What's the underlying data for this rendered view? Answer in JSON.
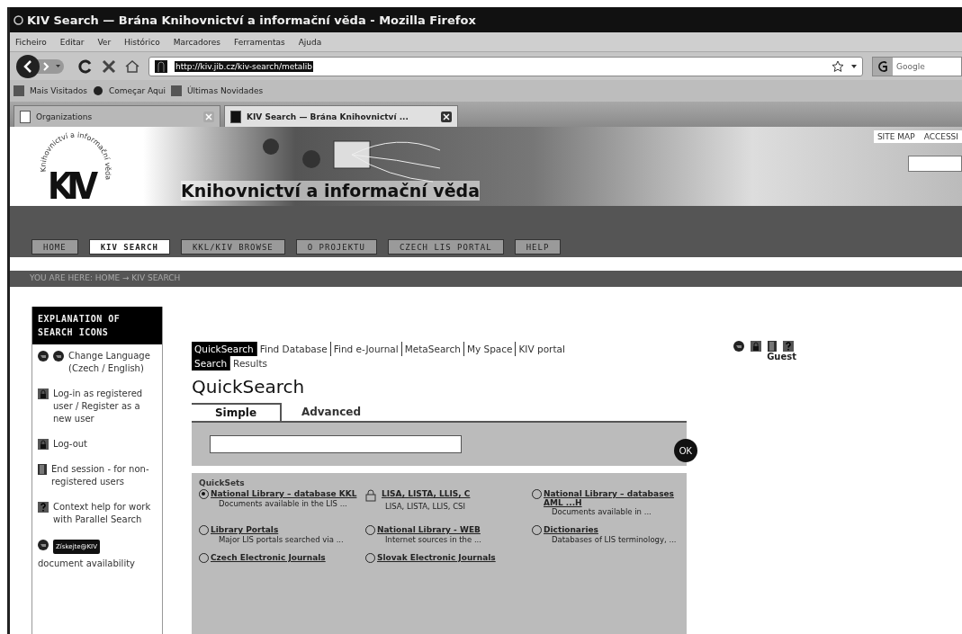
{
  "window": {
    "title": "KIV Search — Brána Knihovnictví a informační věda - Mozilla Firefox"
  },
  "menu": [
    "Ficheiro",
    "Editar",
    "Ver",
    "Histórico",
    "Marcadores",
    "Ferramentas",
    "Ajuda"
  ],
  "toolbar": {
    "url": "http://kiv.jib.cz/kiv-search/metalib",
    "search_placeholder": "Google"
  },
  "bookmarks": [
    "Mais Visitados",
    "Começar Aqui",
    "Últimas Novidades"
  ],
  "browser_tabs": [
    {
      "label": "Organizations",
      "selected": false
    },
    {
      "label": "KIV Search — Brána Knihovnictví ...",
      "selected": true
    }
  ],
  "site": {
    "logo": "KIV",
    "logo_arc": "Knihovnictví a informační věda",
    "banner_title": "Knihovnictví a informační věda",
    "top_links": [
      "SITE MAP",
      "ACCESSI"
    ],
    "nav": [
      {
        "label": "HOME",
        "selected": false
      },
      {
        "label": "KIV SEARCH",
        "selected": true
      },
      {
        "label": "KKL/KIV BROWSE",
        "selected": false
      },
      {
        "label": "O PROJEKTU",
        "selected": false
      },
      {
        "label": "CZECH LIS PORTAL",
        "selected": false
      },
      {
        "label": "HELP",
        "selected": false
      }
    ],
    "breadcrumb": "YOU ARE HERE: HOME → KIV SEARCH"
  },
  "sidebar": {
    "title": "EXPLANATION OF SEARCH ICONS",
    "items": [
      {
        "kind": "language",
        "text": "Change Language (Czech / English)"
      },
      {
        "kind": "login",
        "text": "Log-in as registered user / Register as a new user"
      },
      {
        "kind": "logout",
        "text": "Log-out"
      },
      {
        "kind": "end",
        "text": "End session - for non-registered users"
      },
      {
        "kind": "help",
        "text": "Context help for work with Parallel Search"
      },
      {
        "kind": "availability",
        "badge": "Získejte@KIV",
        "text": "document availability"
      }
    ]
  },
  "app_nav": [
    [
      {
        "label": "QuickSearch",
        "selected": true
      },
      {
        "label": "Find Database",
        "selected": false
      },
      {
        "label": "Find e-Journal",
        "selected": false
      },
      {
        "label": "MetaSearch",
        "selected": false
      },
      {
        "label": "My Space",
        "selected": false
      },
      {
        "label": "KIV portal",
        "selected": false
      }
    ],
    [
      {
        "label": "Search",
        "selected": true
      },
      {
        "label": "Results",
        "selected": false
      }
    ]
  ],
  "user": "Guest",
  "heading": "QuickSearch",
  "search_tabs": [
    {
      "label": "Simple",
      "selected": true
    },
    {
      "label": "Advanced",
      "selected": false
    }
  ],
  "ok_button": "OK",
  "quicksets": {
    "title": "QuickSets",
    "items": [
      {
        "kind": "radio",
        "selected": true,
        "title": "National Library – database KKL",
        "description": "Documents available in the LIS ..."
      },
      {
        "kind": "locked",
        "title": "LISA, LISTA, LLIS, C",
        "description": "LISA, LISTA, LLIS, CSI"
      },
      {
        "kind": "radio",
        "selected": false,
        "title": "National Library – databases AML ...H",
        "description": "Documents available in ..."
      },
      {
        "kind": "radio",
        "selected": false,
        "title": "Library Portals",
        "description": "Major LIS portals searched via ..."
      },
      {
        "kind": "radio",
        "selected": false,
        "title": "National Library - WEB",
        "description": "Internet sources in the ..."
      },
      {
        "kind": "radio",
        "selected": false,
        "title": "Dictionaries",
        "description": "Databases of LIS terminology, ..."
      },
      {
        "kind": "radio",
        "selected": false,
        "title": "Czech Electronic Journals"
      },
      {
        "kind": "radio",
        "selected": false,
        "title": "Slovak Electronic Journals"
      }
    ]
  }
}
